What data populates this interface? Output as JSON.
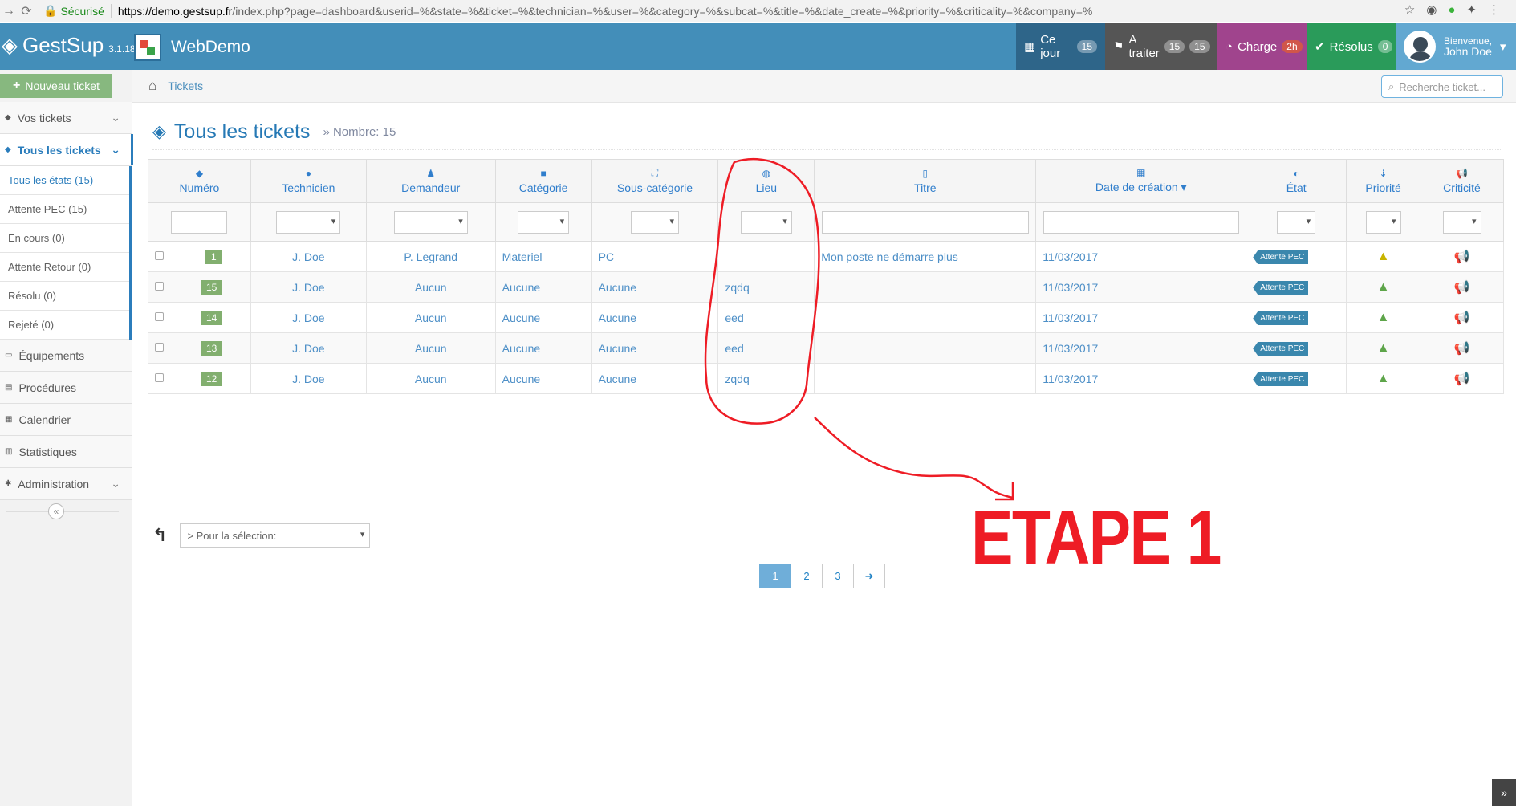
{
  "browser": {
    "secure_label": "Sécurisé",
    "url_host": "https://demo.gestsup.fr",
    "url_rest": "/index.php?page=dashboard&userid=%&state=%&ticket=%&technician=%&user=%&category=%&subcat=%&title=%&date_create=%&priority=%&criticality=%&company=%"
  },
  "brand": {
    "name": "GestSup",
    "version": "3.1.18",
    "site": "WebDemo"
  },
  "topnav": {
    "today": {
      "label": "Ce jour",
      "badge": "15"
    },
    "todo": {
      "label": "A traiter",
      "badge1": "15",
      "badge2": "15"
    },
    "charge": {
      "label": "Charge",
      "badge": "2h"
    },
    "solved": {
      "label": "Résolus",
      "badge": "0"
    },
    "user": {
      "welcome": "Bienvenue,",
      "name": "John Doe"
    }
  },
  "sidebar": {
    "new_ticket": "Nouveau ticket",
    "your_tickets": "Vos tickets",
    "all_tickets": "Tous les tickets",
    "sub": [
      "Tous les états (15)",
      "Attente PEC (15)",
      "En cours (0)",
      "Attente Retour (0)",
      "Résolu (0)",
      "Rejeté (0)"
    ],
    "equipments": "Équipements",
    "procedures": "Procédures",
    "calendar": "Calendrier",
    "stats": "Statistiques",
    "admin": "Administration"
  },
  "breadcrumb": {
    "item": "Tickets"
  },
  "search": {
    "placeholder": "Recherche ticket..."
  },
  "page": {
    "title": "Tous les tickets",
    "count": "Nombre: 15"
  },
  "table": {
    "columns": {
      "numero": "Numéro",
      "technicien": "Technicien",
      "demandeur": "Demandeur",
      "categorie": "Catégorie",
      "souscategorie": "Sous-catégorie",
      "lieu": "Lieu",
      "titre": "Titre",
      "date": "Date de création",
      "etat": "État",
      "priorite": "Priorité",
      "criticite": "Criticité"
    },
    "rows": [
      {
        "num": "1",
        "tech": "J. Doe",
        "dem": "P. Legrand",
        "cat": "Materiel",
        "sub": "PC",
        "lieu": "",
        "titre": "Mon poste ne démarre plus",
        "date": "11/03/2017",
        "etat": "Attente PEC"
      },
      {
        "num": "15",
        "tech": "J. Doe",
        "dem": "Aucun",
        "cat": "Aucune",
        "sub": "Aucune",
        "lieu": "zqdq",
        "titre": "",
        "date": "11/03/2017",
        "etat": "Attente PEC"
      },
      {
        "num": "14",
        "tech": "J. Doe",
        "dem": "Aucun",
        "cat": "Aucune",
        "sub": "Aucune",
        "lieu": "eed",
        "titre": "",
        "date": "11/03/2017",
        "etat": "Attente PEC"
      },
      {
        "num": "13",
        "tech": "J. Doe",
        "dem": "Aucun",
        "cat": "Aucune",
        "sub": "Aucune",
        "lieu": "eed",
        "titre": "",
        "date": "11/03/2017",
        "etat": "Attente PEC"
      },
      {
        "num": "12",
        "tech": "J. Doe",
        "dem": "Aucun",
        "cat": "Aucune",
        "sub": "Aucune",
        "lieu": "zqdq",
        "titre": "",
        "date": "11/03/2017",
        "etat": "Attente PEC"
      }
    ]
  },
  "bulk": {
    "placeholder": "> Pour la sélection:"
  },
  "pager": {
    "p1": "1",
    "p2": "2",
    "p3": "3"
  },
  "annotation": {
    "text": "ETAPE 1",
    "color": "#ee1c25"
  }
}
